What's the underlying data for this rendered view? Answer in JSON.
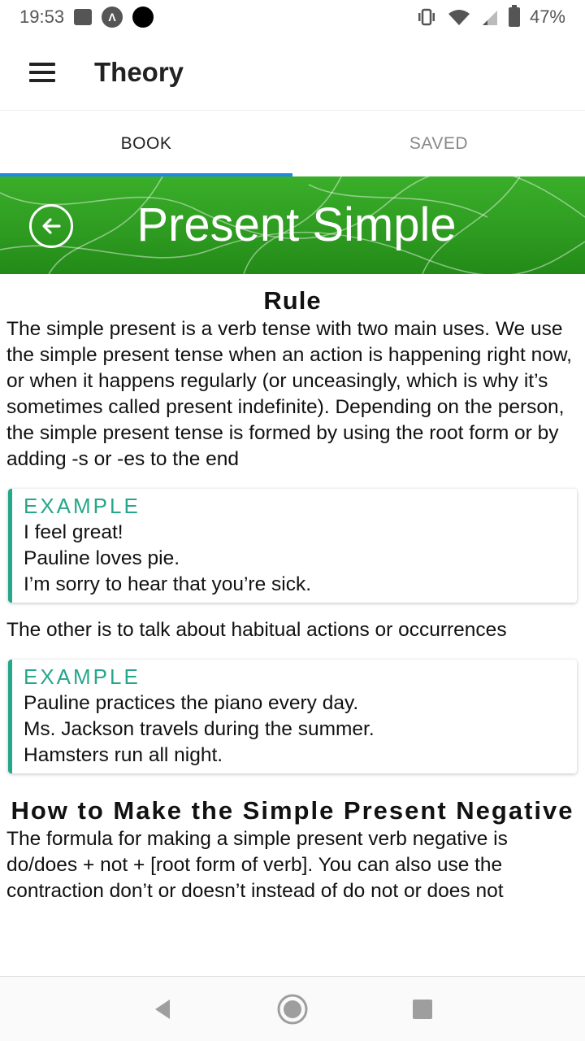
{
  "status_bar": {
    "time": "19:53",
    "battery": "47%"
  },
  "app_bar": {
    "title": "Theory"
  },
  "tabs": [
    {
      "label": "BOOK",
      "active": true
    },
    {
      "label": "SAVED",
      "active": false
    }
  ],
  "banner": {
    "title": "Present Simple"
  },
  "content": {
    "rule_heading": "Rule",
    "rule_text": "The simple present is a verb tense with two main uses. We use the simple present tense when an action is happening right now, or when it happens regularly (or unceasingly, which is why it’s sometimes called present indefinite). Depending on the person, the simple present tense is formed by using the root form or by adding -s or -es to the end",
    "example1": {
      "label": "EXAMPLE",
      "lines": [
        "I feel great!",
        "Pauline loves pie.",
        "I’m sorry to hear that you’re sick."
      ]
    },
    "mid_text": "The other is to talk about habitual actions or occurrences",
    "example2": {
      "label": "EXAMPLE",
      "lines": [
        "Pauline practices the piano every day.",
        "Ms. Jackson travels during the summer.",
        "Hamsters run all night."
      ]
    },
    "negative_heading": "How to Make the Simple Present Negative",
    "negative_text": "The formula for making a simple present verb negative is do/does + not + [root form of verb]. You can also use the contraction don’t or doesn’t instead of do not or does not"
  },
  "colors": {
    "accent_tab": "#1e88e5",
    "banner_green": "#2d9a20",
    "example_teal": "#26a68a"
  },
  "icons": [
    "image-icon",
    "a-circle-icon",
    "dot-icon",
    "vibrate-icon",
    "wifi-icon",
    "signal-icon",
    "battery-icon",
    "menu-icon",
    "back-arrow-icon",
    "nav-back-icon",
    "nav-home-icon",
    "nav-recents-icon"
  ]
}
